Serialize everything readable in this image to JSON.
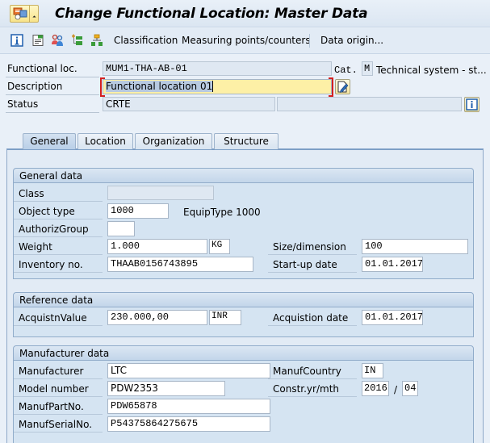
{
  "window": {
    "title": "Change Functional Location: Master Data"
  },
  "toolbar": {
    "icons": [
      "info-icon",
      "display-document-icon",
      "partners-icon",
      "hierarchy-add-icon",
      "structure-icon"
    ],
    "classification_label": "Classification",
    "measuring_points_label": "Measuring points/counters",
    "data_origin_label": "Data origin..."
  },
  "header": {
    "functional_loc_label": "Functional loc.",
    "functional_loc_value": "MUM1-THA-AB-01",
    "cat_label": "Cat.",
    "cat_value": "M",
    "cat_text": "Technical system - st...",
    "description_label": "Description",
    "description_value": "Functional location 01",
    "status_label": "Status",
    "status_value": "CRTE",
    "status_value2": ""
  },
  "tabs": [
    {
      "label": "General",
      "active": true
    },
    {
      "label": "Location",
      "active": false
    },
    {
      "label": "Organization",
      "active": false
    },
    {
      "label": "Structure",
      "active": false
    }
  ],
  "general_data": {
    "title": "General data",
    "class_label": "Class",
    "class_value": "",
    "object_type_label": "Object type",
    "object_type_value": "1000",
    "object_type_text": "EquipType 1000",
    "authoriz_group_label": "AuthorizGroup",
    "authoriz_group_value": "",
    "weight_label": "Weight",
    "weight_value": "1.000",
    "weight_unit": "KG",
    "size_label": "Size/dimension",
    "size_value": "100",
    "inventory_label": "Inventory no.",
    "inventory_value": "THAAB0156743895",
    "startup_label": "Start-up date",
    "startup_value": "01.01.2017"
  },
  "reference_data": {
    "title": "Reference data",
    "acq_value_label": "AcquistnValue",
    "acq_value": "230.000,00",
    "acq_currency": "INR",
    "acq_date_label": "Acquistion date",
    "acq_date_value": "01.01.2017"
  },
  "manufacturer_data": {
    "title": "Manufacturer data",
    "manufacturer_label": "Manufacturer",
    "manufacturer_value": "LTC",
    "country_label": "ManufCountry",
    "country_value": "IN",
    "model_label": "Model number",
    "model_value": "PDW2353",
    "constr_label": "Constr.yr/mth",
    "constr_year": "2016",
    "constr_sep": "/",
    "constr_month": "04",
    "part_label": "ManufPartNo.",
    "part_value": "PDW65878",
    "serial_label": "ManufSerialNo.",
    "serial_value": "P54375864275675"
  }
}
